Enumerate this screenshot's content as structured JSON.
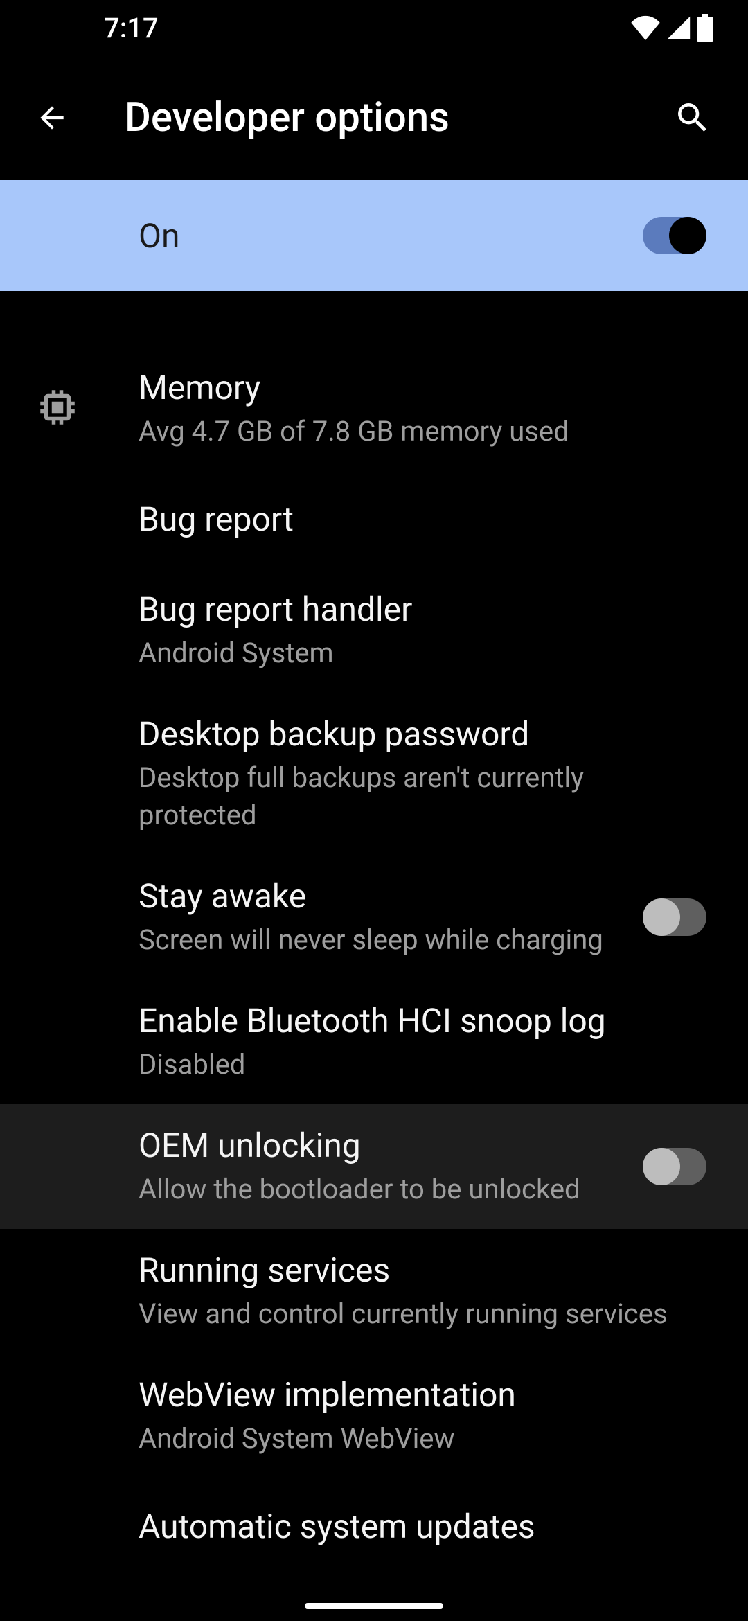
{
  "status": {
    "time": "7:17"
  },
  "header": {
    "title": "Developer options"
  },
  "master": {
    "label": "On"
  },
  "items": {
    "memory": {
      "title": "Memory",
      "subtitle": "Avg 4.7 GB of 7.8 GB memory used"
    },
    "bug_report": {
      "title": "Bug report"
    },
    "bug_report_handler": {
      "title": "Bug report handler",
      "subtitle": "Android System"
    },
    "desktop_backup": {
      "title": "Desktop backup password",
      "subtitle": "Desktop full backups aren't currently protected"
    },
    "stay_awake": {
      "title": "Stay awake",
      "subtitle": "Screen will never sleep while charging"
    },
    "bt_hci": {
      "title": "Enable Bluetooth HCI snoop log",
      "subtitle": "Disabled"
    },
    "oem_unlocking": {
      "title": "OEM unlocking",
      "subtitle": "Allow the bootloader to be unlocked"
    },
    "running_services": {
      "title": "Running services",
      "subtitle": "View and control currently running services"
    },
    "webview": {
      "title": "WebView implementation",
      "subtitle": "Android System WebView"
    },
    "auto_system_updates": {
      "title": "Automatic system updates"
    }
  }
}
